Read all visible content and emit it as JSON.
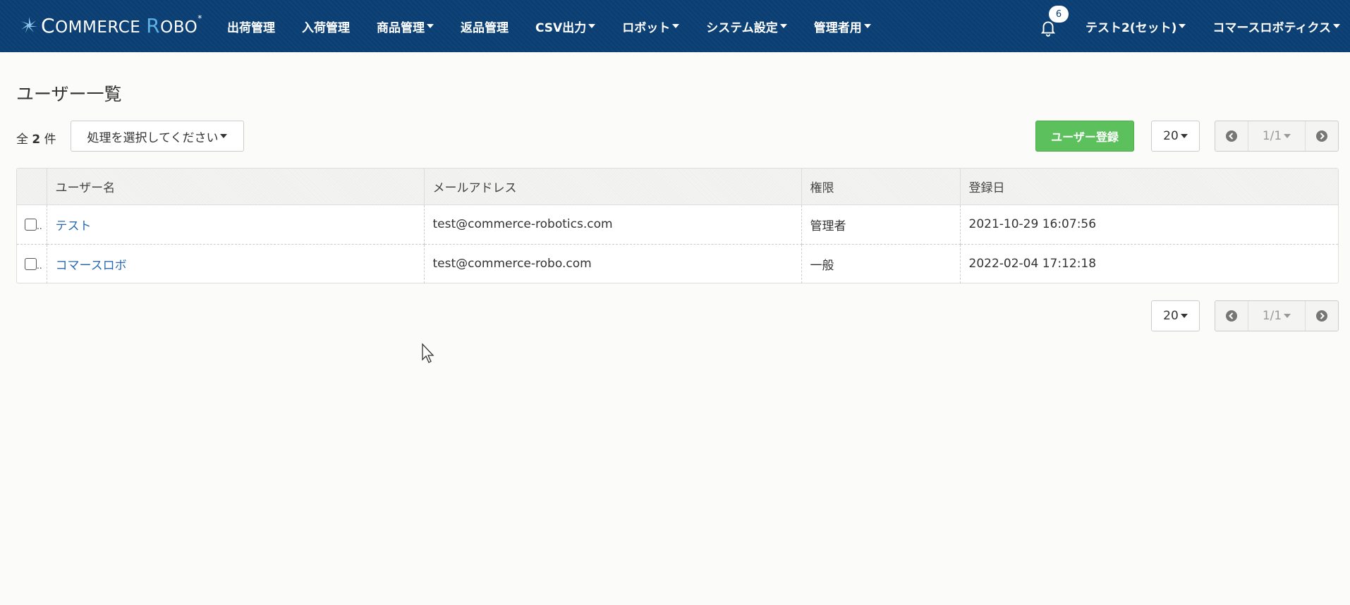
{
  "brand": {
    "c": "C",
    "ommerce": "OMMERCE ",
    "r": "R",
    "obo": "OBO",
    "star": "*"
  },
  "menu": {
    "items": [
      {
        "label": "出荷管理",
        "caret": false
      },
      {
        "label": "入荷管理",
        "caret": false
      },
      {
        "label": "商品管理",
        "caret": true
      },
      {
        "label": "返品管理",
        "caret": false
      },
      {
        "label": "CSV出力",
        "caret": true
      },
      {
        "label": "ロボット",
        "caret": true
      },
      {
        "label": "システム設定",
        "caret": true
      },
      {
        "label": "管理者用",
        "caret": true
      }
    ]
  },
  "notifications": {
    "count": "6",
    "icon": "bell-icon"
  },
  "user_menu": {
    "label": "テスト2(セット)"
  },
  "company_menu": {
    "label": "コマースロボティクス"
  },
  "page": {
    "title": "ユーザー一覧"
  },
  "toolbar": {
    "count_prefix": "全",
    "count": "2",
    "count_suffix": "件",
    "action_select": "処理を選択してください",
    "register_button": "ユーザー登録",
    "per_page": "20",
    "page_indicator": "1/1"
  },
  "table": {
    "headers": {
      "name": "ユーザー名",
      "email": "メールアドレス",
      "role": "権限",
      "registered": "登録日"
    },
    "rows": [
      {
        "name": "テスト",
        "email": "test@commerce-robotics.com",
        "role": "管理者",
        "registered": "2021-10-29 16:07:56"
      },
      {
        "name": "コマースロボ",
        "email": "test@commerce-robo.com",
        "role": "一般",
        "registered": "2022-02-04 17:12:18"
      }
    ],
    "overflow_marker": ".."
  },
  "colors": {
    "navbar": "#0b3f73",
    "primary_button": "#5cc05c",
    "link": "#2a6ab0"
  }
}
